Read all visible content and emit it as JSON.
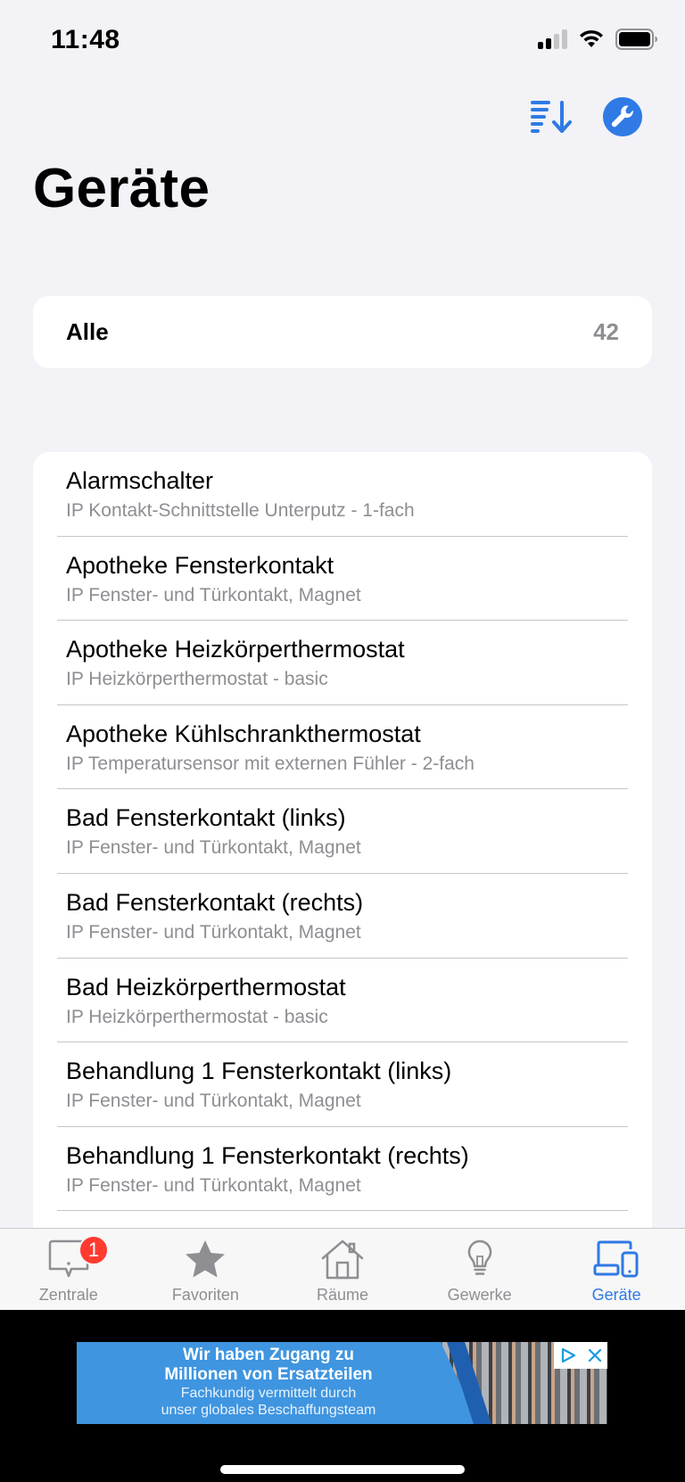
{
  "status_bar": {
    "time": "11:48",
    "icons": [
      "cellular-signal-icon",
      "wifi-icon",
      "battery-icon"
    ]
  },
  "toolbar": {
    "sort_icon": "sort-descending-icon",
    "settings_icon": "wrench-icon",
    "accent_color": "#2f7ae5"
  },
  "page": {
    "title": "Geräte"
  },
  "all_section": {
    "label": "Alle",
    "count": "42"
  },
  "devices": [
    {
      "name": "Alarmschalter",
      "type": "IP Kontakt-Schnittstelle Unterputz - 1-fach"
    },
    {
      "name": "Apotheke Fensterkontakt",
      "type": "IP Fenster- und Türkontakt, Magnet"
    },
    {
      "name": "Apotheke Heizkörperthermostat",
      "type": "IP Heizkörperthermostat - basic"
    },
    {
      "name": "Apotheke Kühlschrankthermostat",
      "type": "IP Temperatursensor mit externen Fühler - 2-fach"
    },
    {
      "name": "Bad Fensterkontakt (links)",
      "type": "IP Fenster- und Türkontakt, Magnet"
    },
    {
      "name": "Bad Fensterkontakt (rechts)",
      "type": "IP Fenster- und Türkontakt, Magnet"
    },
    {
      "name": "Bad Heizkörperthermostat",
      "type": "IP Heizkörperthermostat - basic"
    },
    {
      "name": "Behandlung 1 Fensterkontakt (links)",
      "type": "IP Fenster- und Türkontakt, Magnet"
    },
    {
      "name": "Behandlung 1 Fensterkontakt (rechts)",
      "type": "IP Fenster- und Türkontakt, Magnet"
    }
  ],
  "tab_bar": {
    "tabs": [
      {
        "label": "Zentrale",
        "icon": "hub-icon",
        "badge": "1",
        "active": false
      },
      {
        "label": "Favoriten",
        "icon": "star-icon",
        "active": false
      },
      {
        "label": "Räume",
        "icon": "house-icon",
        "active": false
      },
      {
        "label": "Gewerke",
        "icon": "lightbulb-icon",
        "active": false
      },
      {
        "label": "Geräte",
        "icon": "devices-icon",
        "active": true
      }
    ],
    "active_color": "#2f7ae5",
    "inactive_color": "#8e8e93",
    "badge_color": "#ff3b30"
  },
  "ad": {
    "line1": "Wir haben Zugang zu",
    "line2": "Millionen von Ersatzteilen",
    "line3": "Fachkundig vermittelt durch",
    "line4": "unser globales Beschaffungsteam",
    "icons": [
      "adchoices-icon",
      "close-icon"
    ]
  }
}
